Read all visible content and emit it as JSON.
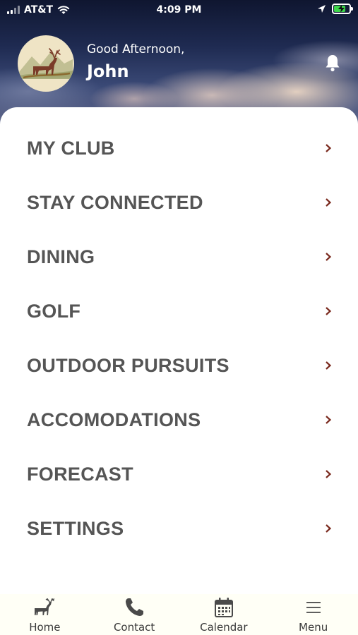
{
  "status_bar": {
    "carrier": "AT&T",
    "time": "4:09 PM",
    "battery_fill": 0.75
  },
  "header": {
    "greeting": "Good Afternoon,",
    "username": "John",
    "logo_icon": "elk-logo-icon",
    "notification_icon": "bell-icon"
  },
  "menu": {
    "items": [
      {
        "label": "MY CLUB"
      },
      {
        "label": "STAY CONNECTED"
      },
      {
        "label": "DINING"
      },
      {
        "label": "GOLF"
      },
      {
        "label": "OUTDOOR PURSUITS"
      },
      {
        "label": "ACCOMODATIONS"
      },
      {
        "label": "FORECAST"
      },
      {
        "label": "SETTINGS"
      }
    ],
    "chevron_color": "#7a2a1e"
  },
  "tab_bar": {
    "tabs": [
      {
        "label": "Home",
        "icon": "elk-icon"
      },
      {
        "label": "Contact",
        "icon": "phone-icon"
      },
      {
        "label": "Calendar",
        "icon": "calendar-icon"
      },
      {
        "label": "Menu",
        "icon": "hamburger-menu-icon"
      }
    ]
  },
  "colors": {
    "menu_text": "#555555",
    "tab_bar_bg": "#fffff6",
    "logo_bg": "#efe4c5"
  }
}
